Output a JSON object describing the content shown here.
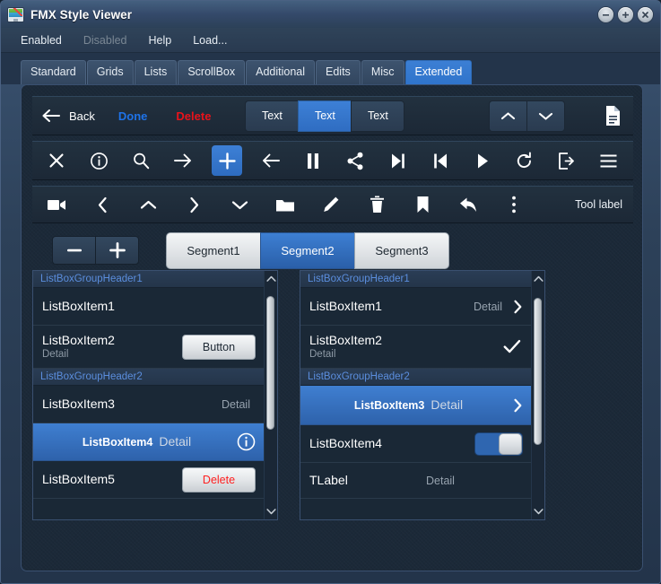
{
  "window": {
    "title": "FMX Style Viewer",
    "app_icon": "monitor-pen-icon",
    "controls": [
      {
        "name": "minimize",
        "glyph": "minus"
      },
      {
        "name": "maximize",
        "glyph": "plus"
      },
      {
        "name": "close",
        "glyph": "cross"
      }
    ]
  },
  "menu": {
    "items": [
      {
        "label": "Enabled",
        "disabled": false
      },
      {
        "label": "Disabled",
        "disabled": true
      },
      {
        "label": "Help",
        "disabled": false
      },
      {
        "label": "Load...",
        "disabled": false
      }
    ]
  },
  "tabs": {
    "items": [
      {
        "label": "Standard",
        "active": false
      },
      {
        "label": "Grids",
        "active": false
      },
      {
        "label": "Lists",
        "active": false
      },
      {
        "label": "ScrollBox",
        "active": false
      },
      {
        "label": "Additional",
        "active": false
      },
      {
        "label": "Edits",
        "active": false
      },
      {
        "label": "Misc",
        "active": false
      },
      {
        "label": "Extended",
        "active": true
      }
    ],
    "active_tab": "Extended"
  },
  "toolbar_top": {
    "back_label": "Back",
    "back_icon": "arrow-left-icon",
    "done_label": "Done",
    "done_color": "#1e73e8",
    "delete_label": "Delete",
    "delete_color": "#e8131b",
    "text_segments": [
      {
        "label": "Text",
        "active": false
      },
      {
        "label": "Text",
        "active": true
      },
      {
        "label": "Text",
        "active": false
      }
    ],
    "up_icon": "chevron-up-icon",
    "down_icon": "chevron-down-icon",
    "doc_icon": "document-icon"
  },
  "toolbar_icons": {
    "items": [
      {
        "icon": "close-icon",
        "accent": false
      },
      {
        "icon": "info-circle-icon",
        "accent": false
      },
      {
        "icon": "search-icon",
        "accent": false
      },
      {
        "icon": "arrow-right-icon",
        "accent": false
      },
      {
        "icon": "plus-icon",
        "accent": true
      },
      {
        "icon": "arrow-left-icon",
        "accent": false
      },
      {
        "icon": "pause-icon",
        "accent": false
      },
      {
        "icon": "share-icon",
        "accent": false
      },
      {
        "icon": "skip-forward-icon",
        "accent": false
      },
      {
        "icon": "skip-backward-icon",
        "accent": false
      },
      {
        "icon": "play-icon",
        "accent": false
      },
      {
        "icon": "refresh-icon",
        "accent": false
      },
      {
        "icon": "logout-icon",
        "accent": false
      },
      {
        "icon": "menu-hamburger-icon",
        "accent": false
      }
    ]
  },
  "toolbar_tools": {
    "items": [
      {
        "icon": "video-camera-icon"
      },
      {
        "icon": "chevron-left-icon"
      },
      {
        "icon": "chevron-up-icon"
      },
      {
        "icon": "chevron-right-icon"
      },
      {
        "icon": "chevron-down-icon"
      },
      {
        "icon": "folder-icon"
      },
      {
        "icon": "pencil-icon"
      },
      {
        "icon": "trash-icon"
      },
      {
        "icon": "bookmark-icon"
      },
      {
        "icon": "reply-arrow-icon"
      },
      {
        "icon": "more-vertical-icon"
      }
    ],
    "label": "Tool label"
  },
  "stepper": {
    "minus_label": "−",
    "plus_label": "+"
  },
  "segmented_control": {
    "segments": [
      {
        "label": "Segment1",
        "active": false
      },
      {
        "label": "Segment2",
        "active": true
      },
      {
        "label": "Segment3",
        "active": false
      }
    ],
    "active": "Segment2"
  },
  "listbox_left": {
    "rows": [
      {
        "type": "group",
        "title": "ListBoxGroupHeader1"
      },
      {
        "type": "item",
        "title": "ListBoxItem1",
        "sub": "",
        "detail": "",
        "accessory": "none",
        "selected": false,
        "height": 42
      },
      {
        "type": "item",
        "title": "ListBoxItem2",
        "sub": "Detail",
        "detail": "",
        "accessory": "button",
        "button_label": "Button",
        "selected": false,
        "height": 48
      },
      {
        "type": "group",
        "title": "ListBoxGroupHeader2"
      },
      {
        "type": "item",
        "title": "ListBoxItem3",
        "sub": "",
        "detail": "Detail",
        "accessory": "none",
        "selected": false,
        "height": 42
      },
      {
        "type": "item",
        "title": "ListBoxItem4",
        "sub": "",
        "detail": "Detail",
        "accessory": "info",
        "selected": true,
        "height": 42
      },
      {
        "type": "item",
        "title": "ListBoxItem5",
        "sub": "",
        "detail": "",
        "accessory": "button",
        "button_label": "Delete",
        "button_style": "danger",
        "selected": false,
        "height": 42
      }
    ],
    "scroll": {
      "up_icon": "chevron-up-icon",
      "down_icon": "chevron-down-icon",
      "thumb_top_pct": 4,
      "thumb_height_pct": 62
    }
  },
  "listbox_right": {
    "rows": [
      {
        "type": "group",
        "title": "ListBoxGroupHeader1"
      },
      {
        "type": "item",
        "title": "ListBoxItem1",
        "sub": "",
        "detail": "Detail",
        "accessory": "chevron",
        "selected": false,
        "height": 42
      },
      {
        "type": "item",
        "title": "ListBoxItem2",
        "sub": "Detail",
        "detail": "",
        "accessory": "check",
        "selected": false,
        "height": 48
      },
      {
        "type": "group",
        "title": "ListBoxGroupHeader2"
      },
      {
        "type": "item",
        "title": "ListBoxItem3",
        "sub": "",
        "detail": "Detail",
        "accessory": "chevron",
        "selected": true,
        "height": 44
      },
      {
        "type": "item",
        "title": "ListBoxItem4",
        "sub": "",
        "detail": "",
        "accessory": "toggle",
        "toggle_on": true,
        "selected": false,
        "height": 42
      },
      {
        "type": "item",
        "title": "TLabel",
        "sub": "",
        "detail": "Detail",
        "accessory": "none",
        "selected": false,
        "height": 40
      }
    ],
    "scroll": {
      "up_icon": "chevron-up-icon",
      "down_icon": "chevron-down-icon",
      "thumb_top_pct": 5,
      "thumb_height_pct": 68
    }
  },
  "colors": {
    "accent": "#2f6dc2",
    "window_chrome": "#34496a",
    "panel_bg": "#1b2938",
    "group_header_text": "#5b8ede",
    "danger": "#e8131b",
    "link": "#1e73e8"
  }
}
